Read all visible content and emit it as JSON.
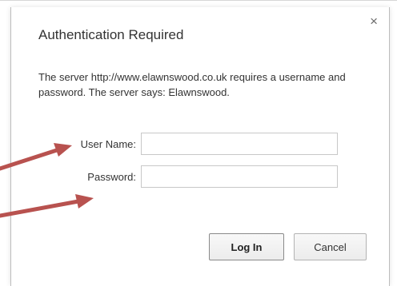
{
  "dialog": {
    "title": "Authentication Required",
    "close_glyph": "×",
    "message": "The server http://www.elawnswood.co.uk requires a username and password. The server says: Elawnswood.",
    "username_label": "User Name:",
    "username_value": "",
    "password_label": "Password:",
    "password_value": "",
    "login_label": "Log In",
    "cancel_label": "Cancel"
  },
  "annotations": {
    "arrow_color": "#b8524f",
    "arrow_count": 2
  },
  "colors": {
    "title_text": "#333333",
    "border": "#c8c8c8"
  },
  "icons": [
    "close-icon",
    "arrow-annotation"
  ]
}
